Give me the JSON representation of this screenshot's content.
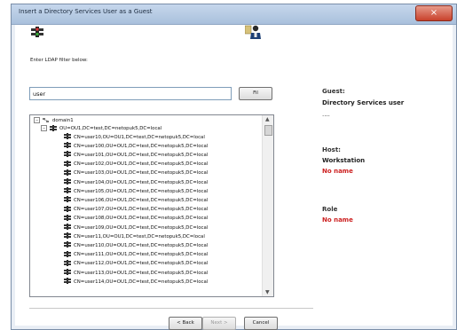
{
  "window": {
    "title": "Insert a Directory Services User as a Guest",
    "close_glyph": "×"
  },
  "ldap_label": "Enter LDAP filter below:",
  "filter": {
    "value": "user",
    "button": "Fil"
  },
  "tree": {
    "root": "domain1",
    "ou": "OU=OU1,DC=test,DC=netopuk5,DC=local",
    "items": [
      "CN=user10,OU=OU1,DC=test,DC=netopuk5,DC=local",
      "CN=user100,OU=OU1,DC=test,DC=netopuk5,DC=local",
      "CN=user101,OU=OU1,DC=test,DC=netopuk5,DC=local",
      "CN=user102,OU=OU1,DC=test,DC=netopuk5,DC=local",
      "CN=user103,OU=OU1,DC=test,DC=netopuk5,DC=local",
      "CN=user104,OU=OU1,DC=test,DC=netopuk5,DC=local",
      "CN=user105,OU=OU1,DC=test,DC=netopuk5,DC=local",
      "CN=user106,OU=OU1,DC=test,DC=netopuk5,DC=local",
      "CN=user107,OU=OU1,DC=test,DC=netopuk5,DC=local",
      "CN=user108,OU=OU1,DC=test,DC=netopuk5,DC=local",
      "CN=user109,OU=OU1,DC=test,DC=netopuk5,DC=local",
      "CN=user11,OU=OU1,DC=test,DC=netopuk5,DC=local",
      "CN=user110,OU=OU1,DC=test,DC=netopuk5,DC=local",
      "CN=user111,OU=OU1,DC=test,DC=netopuk5,DC=local",
      "CN=user112,OU=OU1,DC=test,DC=netopuk5,DC=local",
      "CN=user113,OU=OU1,DC=test,DC=netopuk5,DC=local",
      "CN=user114,OU=OU1,DC=test,DC=netopuk5,DC=local"
    ]
  },
  "buttons": {
    "back": "< Back",
    "next": "Next >",
    "cancel": "Cancel"
  },
  "info": {
    "guest_label": "Guest:",
    "guest_value": "Directory Services user",
    "guest_extra": "....",
    "host_label": "Host:",
    "host_value": "Workstation",
    "host_name": "No name",
    "role_label": "Role",
    "role_value": "No name"
  },
  "colors": {
    "warning": "#cc1f1f"
  },
  "icons": {
    "traffic": "traffic-light-icon",
    "user": "user-icon",
    "domain": "domain-icon",
    "ou": "org-unit-icon",
    "user_item": "user-node-icon"
  }
}
